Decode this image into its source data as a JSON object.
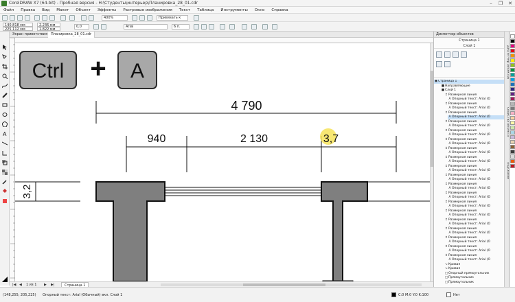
{
  "window": {
    "title": "CorelDRAW X7 (64-bit) - Пробная версия - H:\\Студенты\\интерьер\\Планировка_28_01.cdr",
    "controls": [
      "–",
      "❐",
      "✕"
    ]
  },
  "menu": [
    "Файл",
    "Правка",
    "Вид",
    "Макет",
    "Объект",
    "Эффекты",
    "Растровые изображения",
    "Текст",
    "Таблица",
    "Инструменты",
    "Окно",
    "Справка"
  ],
  "toolbar": {
    "x_value": "140,818 мм",
    "y_value": "225,112 мм",
    "w_value": "2,236 мм",
    "h_value": "1,822 мм",
    "angle_value": "0,0",
    "zoom_value": "400%",
    "snap_label": "Привязать к",
    "font_name": "Arial",
    "font_size": "6 п."
  },
  "tabs": [
    {
      "label": "Экран приветствия",
      "active": false
    },
    {
      "label": "Планировка_28_01.cdr",
      "active": true
    }
  ],
  "drawing": {
    "shortcut_keys": [
      "Ctrl",
      "+",
      "A"
    ],
    "dim_total": "4 790",
    "dim_left": "940",
    "dim_middle": "2 130",
    "dim_right": "3,7",
    "dim_vertical": "3,2"
  },
  "docker": {
    "title": "Диспетчер объектов",
    "page_label": "Страница 1",
    "layer_label": "Слой 1",
    "tree": [
      {
        "text": "Страница 1",
        "indent": 0,
        "glyph": "▣",
        "selected": true
      },
      {
        "text": "Направляющие",
        "indent": 2,
        "glyph": "■",
        "selected": false
      },
      {
        "text": "Слой 1",
        "indent": 2,
        "glyph": "■",
        "selected": false
      },
      {
        "text": "Размерная линия",
        "indent": 3,
        "glyph": "↕",
        "selected": false
      },
      {
        "text": "Опорный текст: Arial (O",
        "indent": 4,
        "glyph": "A",
        "selected": false
      },
      {
        "text": "Размерная линия",
        "indent": 3,
        "glyph": "↕",
        "selected": false
      },
      {
        "text": "Опорный текст: Arial (O",
        "indent": 4,
        "glyph": "A",
        "selected": false
      },
      {
        "text": "Размерная линия",
        "indent": 3,
        "glyph": "↕",
        "selected": false
      },
      {
        "text": "Опорный текст: Arial (O",
        "indent": 4,
        "glyph": "A",
        "selected": true
      },
      {
        "text": "Размерная линия",
        "indent": 3,
        "glyph": "↕",
        "selected": false
      },
      {
        "text": "Опорный текст: Arial (O",
        "indent": 4,
        "glyph": "A",
        "selected": false
      },
      {
        "text": "Размерная линия",
        "indent": 3,
        "glyph": "↕",
        "selected": false
      },
      {
        "text": "Опорный текст: Arial (O",
        "indent": 4,
        "glyph": "A",
        "selected": false
      },
      {
        "text": "Размерная линия",
        "indent": 3,
        "glyph": "↕",
        "selected": false
      },
      {
        "text": "Опорный текст: Arial (O",
        "indent": 4,
        "glyph": "A",
        "selected": false
      },
      {
        "text": "Размерная линия",
        "indent": 3,
        "glyph": "↕",
        "selected": false
      },
      {
        "text": "Опорный текст: Arial (O",
        "indent": 4,
        "glyph": "A",
        "selected": false
      },
      {
        "text": "Размерная линия",
        "indent": 3,
        "glyph": "↕",
        "selected": false
      },
      {
        "text": "Опорный текст: Arial (O",
        "indent": 4,
        "glyph": "A",
        "selected": false
      },
      {
        "text": "Размерная линия",
        "indent": 3,
        "glyph": "↕",
        "selected": false
      },
      {
        "text": "Опорный текст: Arial (O",
        "indent": 4,
        "glyph": "A",
        "selected": false
      },
      {
        "text": "Размерная линия",
        "indent": 3,
        "glyph": "↕",
        "selected": false
      },
      {
        "text": "Опорный текст: Arial (O",
        "indent": 4,
        "glyph": "A",
        "selected": false
      },
      {
        "text": "Размерная линия",
        "indent": 3,
        "glyph": "↕",
        "selected": false
      },
      {
        "text": "Опорный текст: Arial (O",
        "indent": 4,
        "glyph": "A",
        "selected": false
      },
      {
        "text": "Размерная линия",
        "indent": 3,
        "glyph": "↕",
        "selected": false
      },
      {
        "text": "Опорный текст: Arial (O",
        "indent": 4,
        "glyph": "A",
        "selected": false
      },
      {
        "text": "Размерная линия",
        "indent": 3,
        "glyph": "↕",
        "selected": false
      },
      {
        "text": "Опорный текст: Arial (O",
        "indent": 4,
        "glyph": "A",
        "selected": false
      },
      {
        "text": "Размерная линия",
        "indent": 3,
        "glyph": "↕",
        "selected": false
      },
      {
        "text": "Опорный текст: Arial (O",
        "indent": 4,
        "glyph": "A",
        "selected": false
      },
      {
        "text": "Размерная линия",
        "indent": 3,
        "glyph": "↕",
        "selected": false
      },
      {
        "text": "Опорный текст: Arial (O",
        "indent": 4,
        "glyph": "A",
        "selected": false
      },
      {
        "text": "Размерная линия",
        "indent": 3,
        "glyph": "↕",
        "selected": false
      },
      {
        "text": "Опорный текст: Arial (O",
        "indent": 4,
        "glyph": "A",
        "selected": false
      },
      {
        "text": "Размерная линия",
        "indent": 3,
        "glyph": "↕",
        "selected": false
      },
      {
        "text": "Опорный текст: Arial (O",
        "indent": 4,
        "glyph": "A",
        "selected": false
      },
      {
        "text": "Размерная линия",
        "indent": 3,
        "glyph": "↕",
        "selected": false
      },
      {
        "text": "Опорный текст: Arial (O",
        "indent": 4,
        "glyph": "A",
        "selected": false
      },
      {
        "text": "Размерная линия",
        "indent": 3,
        "glyph": "↕",
        "selected": false
      },
      {
        "text": "Опорный текст: Arial (O",
        "indent": 4,
        "glyph": "A",
        "selected": false
      },
      {
        "text": "Кривая",
        "indent": 3,
        "glyph": "∿",
        "selected": false
      },
      {
        "text": "Кривая",
        "indent": 3,
        "glyph": "∿",
        "selected": false
      },
      {
        "text": "Опорный прямоугольник",
        "indent": 3,
        "glyph": "□",
        "selected": false
      },
      {
        "text": "Прямоугольник",
        "indent": 3,
        "glyph": "□",
        "selected": false
      },
      {
        "text": "Прямоугольник",
        "indent": 3,
        "glyph": "□",
        "selected": false
      }
    ]
  },
  "right_tabs": [
    "Диспетчер объектов",
    "Свойства объекта",
    "Подсказки"
  ],
  "pager": {
    "page_count": "1 из 1",
    "page_tab": "Страница 1"
  },
  "status": {
    "coords": "(148,255; 205,225)",
    "object_info": "Опорный текст: Arial (Обычный) вкл. Слой 1",
    "color_info": "C:0 M:0 Y:0 K:100",
    "stroke_info": "Нет"
  },
  "palette_colors": [
    "#ffffff",
    "#000000",
    "#e6007e",
    "#e30613",
    "#f39200",
    "#ffed00",
    "#95c11f",
    "#009640",
    "#00a19a",
    "#009fe3",
    "#1d71b8",
    "#312783",
    "#662483",
    "#a3195b",
    "#b5b5b5",
    "#7b7b7b",
    "#f9b2c5",
    "#fbd3a4",
    "#fff8a8",
    "#cde5aa",
    "#a9d6e5",
    "#c7b8dc",
    "#e6d2b0",
    "#8c6239",
    "#3c3c3c",
    "#dadada",
    "#ea5b0c",
    "#be1622"
  ],
  "colors": {
    "wall_fill": "#7f7f7f",
    "highlight": "#f6e35a",
    "key_fill": "#a8a8a8"
  }
}
